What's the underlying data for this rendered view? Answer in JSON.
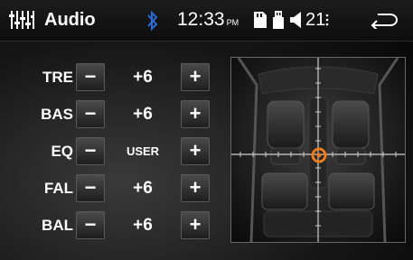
{
  "header": {
    "title": "Audio",
    "time": "12:33",
    "ampm": "PM",
    "volume": "21",
    "icons": [
      "equalizer-icon",
      "bluetooth-icon",
      "sd-card-icon",
      "usb-icon",
      "speaker-icon",
      "back-icon"
    ],
    "bluetooth_color": "#2a6bd8"
  },
  "controls": [
    {
      "label": "TRE",
      "value": "+6",
      "minus": "−",
      "plus": "+"
    },
    {
      "label": "BAS",
      "value": "+6",
      "minus": "−",
      "plus": "+"
    },
    {
      "label": "EQ",
      "value": "USER",
      "minus": "−",
      "plus": "+"
    },
    {
      "label": "FAL",
      "value": "+6",
      "minus": "−",
      "plus": "+"
    },
    {
      "label": "BAL",
      "value": "+6",
      "minus": "−",
      "plus": "+"
    }
  ],
  "balance_fader": {
    "marker_color": "#f07a1a"
  }
}
